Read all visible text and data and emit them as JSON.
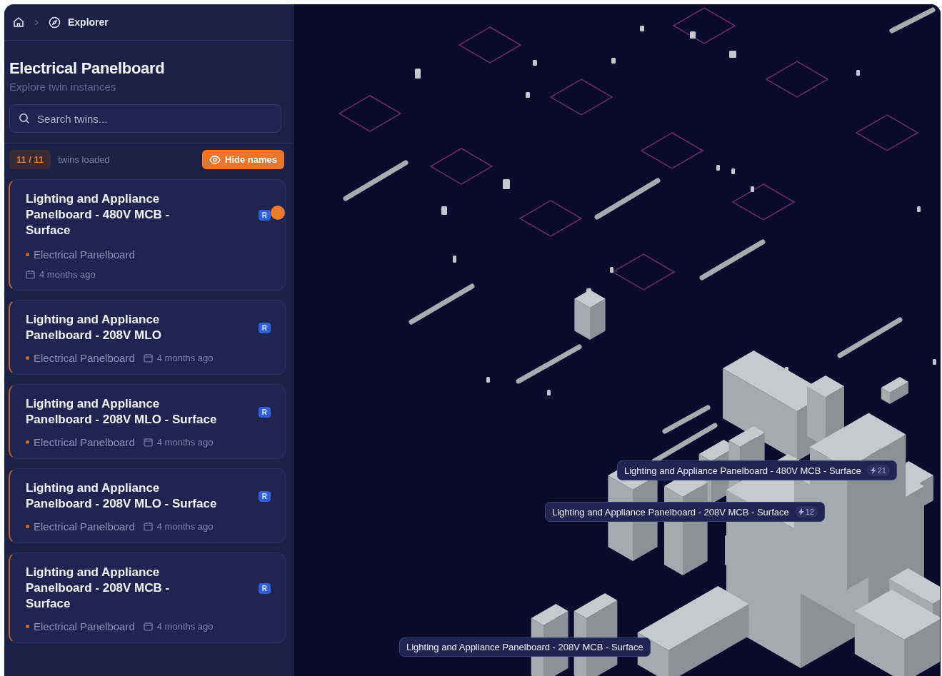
{
  "breadcrumb": {
    "current": "Explorer"
  },
  "header": {
    "title": "Electrical Panelboard",
    "subtitle": "Explore twin instances"
  },
  "search": {
    "placeholder": "Search twins..."
  },
  "counter": {
    "loaded": "11",
    "total": "11",
    "separator": "/",
    "label": "twins loaded"
  },
  "toggle_names": {
    "label": "Hide names",
    "on": true
  },
  "twins": [
    {
      "kind": "stacked",
      "title_lines": [
        "Lighting and Appliance",
        "Panelboard - 480V MCB -",
        "Surface"
      ],
      "badge": "R",
      "active": true,
      "category": "Electrical Panelboard",
      "age": "4 months ago"
    },
    {
      "kind": "inline",
      "title_lines": [
        "Lighting and Appliance",
        "Panelboard - 208V MLO"
      ],
      "badge": "R",
      "active": false,
      "category": "Electrical Panelboard",
      "age": "4 months ago"
    },
    {
      "kind": "inline",
      "title_lines": [
        "Lighting and Appliance",
        "Panelboard - 208V MLO - Surface"
      ],
      "badge": "R",
      "active": false,
      "category": "Electrical Panelboard",
      "age": "4 months ago"
    },
    {
      "kind": "inline",
      "title_lines": [
        "Lighting and Appliance",
        "Panelboard - 208V MLO - Surface"
      ],
      "badge": "R",
      "active": false,
      "category": "Electrical Panelboard",
      "age": "4 months ago"
    },
    {
      "kind": "inline",
      "title_lines": [
        "Lighting and Appliance",
        "Panelboard - 208V MCB -",
        "Surface"
      ],
      "badge": "R",
      "active": false,
      "category": "Electrical Panelboard",
      "age": "4 months ago"
    }
  ],
  "scene_labels": [
    {
      "text": "Lighting and Appliance Panelboard - 480V MCB - Surface",
      "count": "21"
    },
    {
      "text": "Lighting and Appliance Panelboard - 208V MCB - Surface",
      "count": "12"
    },
    {
      "text": "Lighting and Appliance Panelboard - 208V MCB - Surface"
    }
  ]
}
